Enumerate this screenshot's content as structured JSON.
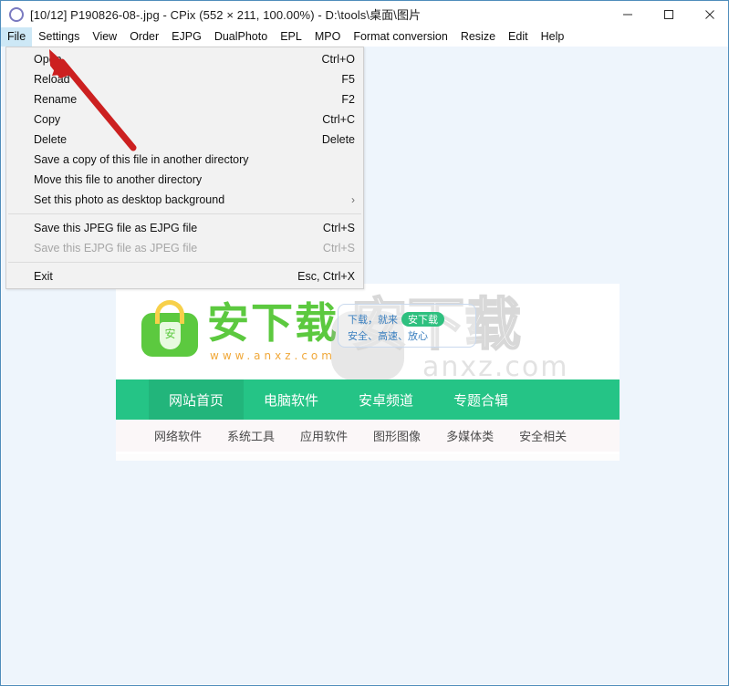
{
  "window": {
    "icon": "circle-icon",
    "title": "[10/12] P190826-08-.jpg - CPix (552 × 211, 100.00%) - D:\\tools\\桌面\\图片",
    "controls": {
      "minimize": "minimize-icon",
      "maximize": "maximize-icon",
      "close": "close-icon"
    }
  },
  "menubar": {
    "items": [
      {
        "label": "File",
        "active": true
      },
      {
        "label": "Settings",
        "active": false
      },
      {
        "label": "View",
        "active": false
      },
      {
        "label": "Order",
        "active": false
      },
      {
        "label": "EJPG",
        "active": false
      },
      {
        "label": "DualPhoto",
        "active": false
      },
      {
        "label": "EPL",
        "active": false
      },
      {
        "label": "MPO",
        "active": false
      },
      {
        "label": "Format conversion",
        "active": false
      },
      {
        "label": "Resize",
        "active": false
      },
      {
        "label": "Edit",
        "active": false
      },
      {
        "label": "Help",
        "active": false
      }
    ]
  },
  "file_menu": {
    "items": [
      {
        "label": "Open",
        "accel": "Ctrl+O",
        "disabled": false,
        "submenu": false
      },
      {
        "label": "Reload",
        "accel": "F5",
        "disabled": false,
        "submenu": false
      },
      {
        "label": "Rename",
        "accel": "F2",
        "disabled": false,
        "submenu": false
      },
      {
        "label": "Copy",
        "accel": "Ctrl+C",
        "disabled": false,
        "submenu": false
      },
      {
        "label": "Delete",
        "accel": "Delete",
        "disabled": false,
        "submenu": false
      },
      {
        "label": "Save a copy of this file in another directory",
        "accel": "",
        "disabled": false,
        "submenu": false
      },
      {
        "label": "Move this file to another directory",
        "accel": "",
        "disabled": false,
        "submenu": false
      },
      {
        "label": "Set this photo as desktop background",
        "accel": "",
        "disabled": false,
        "submenu": true,
        "submenu_glyph": "›"
      },
      {
        "separator": true
      },
      {
        "label": "Save this JPEG file as EJPG file",
        "accel": "Ctrl+S",
        "disabled": false,
        "submenu": false
      },
      {
        "label": "Save this EJPG file as JPEG file",
        "accel": "Ctrl+S",
        "disabled": true,
        "submenu": false
      },
      {
        "separator": true
      },
      {
        "label": "Exit",
        "accel": "Esc, Ctrl+X",
        "disabled": false,
        "submenu": false
      }
    ]
  },
  "photo": {
    "logo": {
      "brand": "安下载",
      "url": "www.anxz.com",
      "bag_glyph": "安"
    },
    "slogan": {
      "line1": "下载，就来",
      "tag": "安下载",
      "line2": "安全、高速、放心"
    },
    "watermark": {
      "cjk": "安下载",
      "url": "anxz.com"
    },
    "green_nav": [
      {
        "label": "网站首页",
        "active": true
      },
      {
        "label": "电脑软件",
        "active": false
      },
      {
        "label": "安卓频道",
        "active": false
      },
      {
        "label": "专题合辑",
        "active": false
      }
    ],
    "sub_nav": [
      {
        "label": "网络软件"
      },
      {
        "label": "系统工具"
      },
      {
        "label": "应用软件"
      },
      {
        "label": "图形图像"
      },
      {
        "label": "多媒体类"
      },
      {
        "label": "安全相关"
      }
    ]
  },
  "annotation": {
    "arrow": "red-arrow-annotation",
    "color": "#cc2020"
  },
  "colors": {
    "accent_green": "#25c486",
    "accent_green_active": "#22b57b",
    "logo_green": "#5cc93f",
    "logo_orange": "#f0a83a",
    "menu_highlight": "#cde8f6",
    "canvas": "#eef5fc",
    "annotation_red": "#cc2020"
  }
}
